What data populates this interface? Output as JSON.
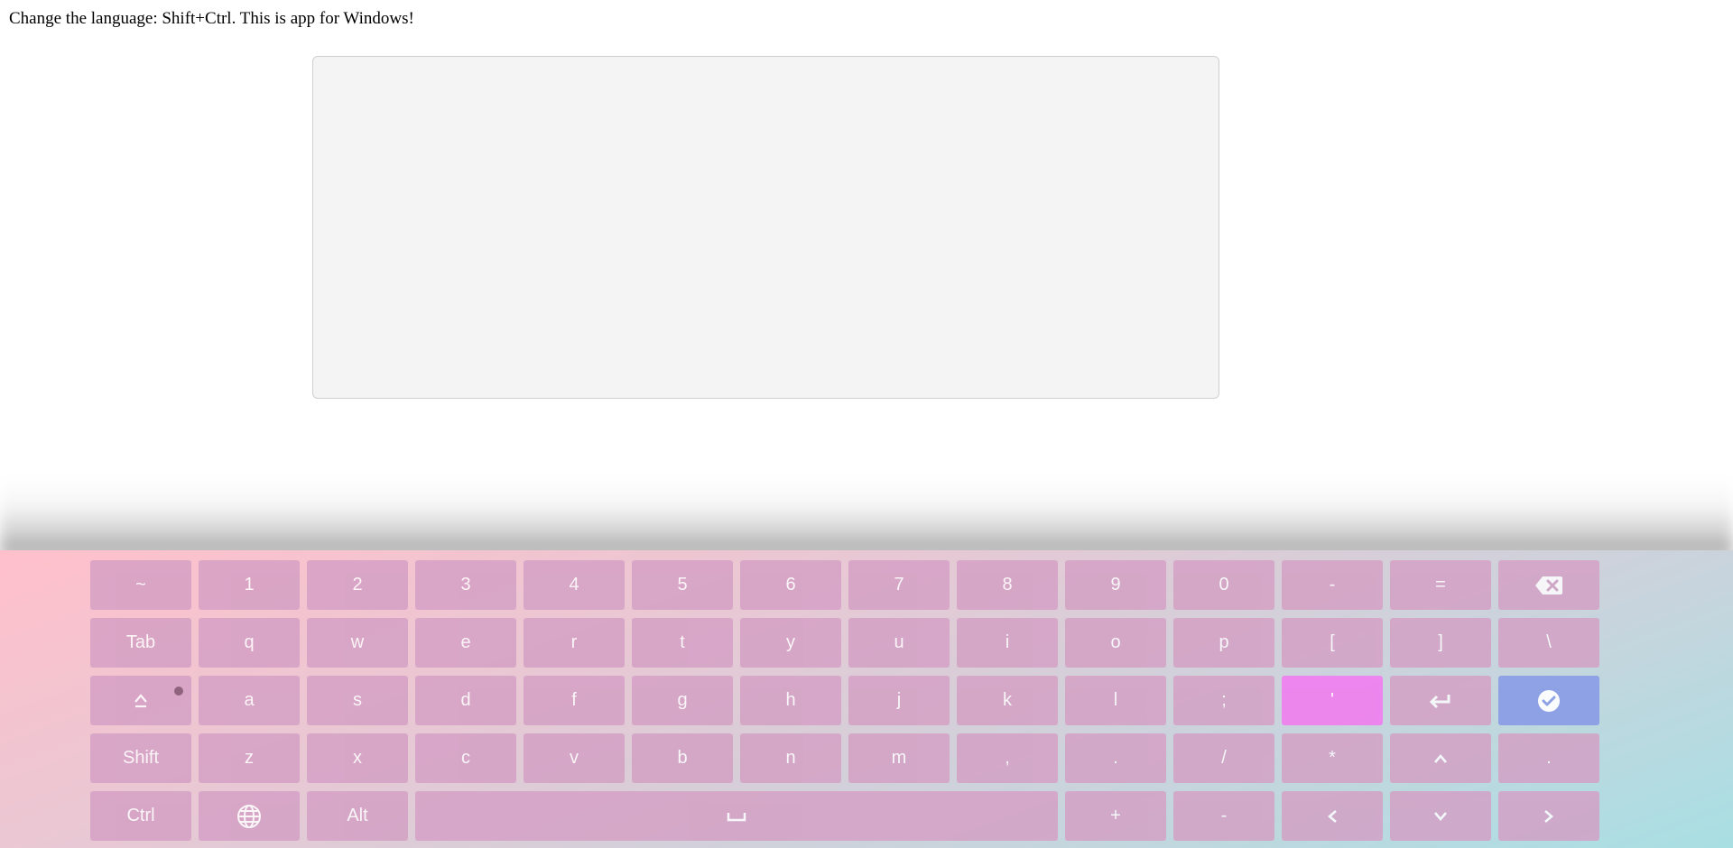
{
  "instruction": "Change the language: Shift+Ctrl. This is app for Windows!",
  "textarea": {
    "value": "",
    "placeholder": ""
  },
  "colors": {
    "key_default": "#d49fc4",
    "key_highlight": "#ee82ee",
    "key_done": "#8c9fe6",
    "gradient_start": "#ffc0cb",
    "gradient_end": "#a8dfe3"
  },
  "keyboard": {
    "rows": [
      [
        {
          "label": "~",
          "name": "key-tilde"
        },
        {
          "label": "1",
          "name": "key-1"
        },
        {
          "label": "2",
          "name": "key-2"
        },
        {
          "label": "3",
          "name": "key-3"
        },
        {
          "label": "4",
          "name": "key-4"
        },
        {
          "label": "5",
          "name": "key-5"
        },
        {
          "label": "6",
          "name": "key-6"
        },
        {
          "label": "7",
          "name": "key-7"
        },
        {
          "label": "8",
          "name": "key-8"
        },
        {
          "label": "9",
          "name": "key-9"
        },
        {
          "label": "0",
          "name": "key-0"
        },
        {
          "label": "-",
          "name": "key-minus"
        },
        {
          "label": "=",
          "name": "key-equals"
        },
        {
          "label": "",
          "name": "backspace-key",
          "icon": "backspace-icon"
        }
      ],
      [
        {
          "label": "Tab",
          "name": "key-tab"
        },
        {
          "label": "q",
          "name": "key-q"
        },
        {
          "label": "w",
          "name": "key-w"
        },
        {
          "label": "e",
          "name": "key-e"
        },
        {
          "label": "r",
          "name": "key-r"
        },
        {
          "label": "t",
          "name": "key-t"
        },
        {
          "label": "y",
          "name": "key-y"
        },
        {
          "label": "u",
          "name": "key-u"
        },
        {
          "label": "i",
          "name": "key-i"
        },
        {
          "label": "o",
          "name": "key-o"
        },
        {
          "label": "p",
          "name": "key-p"
        },
        {
          "label": "[",
          "name": "key-bracket-left"
        },
        {
          "label": "]",
          "name": "key-bracket-right"
        },
        {
          "label": "\\",
          "name": "key-backslash"
        }
      ],
      [
        {
          "label": "",
          "name": "caps-lock-key",
          "icon": "caps-lock-icon",
          "led": true
        },
        {
          "label": "a",
          "name": "key-a"
        },
        {
          "label": "s",
          "name": "key-s"
        },
        {
          "label": "d",
          "name": "key-d"
        },
        {
          "label": "f",
          "name": "key-f"
        },
        {
          "label": "g",
          "name": "key-g"
        },
        {
          "label": "h",
          "name": "key-h"
        },
        {
          "label": "j",
          "name": "key-j"
        },
        {
          "label": "k",
          "name": "key-k"
        },
        {
          "label": "l",
          "name": "key-l"
        },
        {
          "label": ";",
          "name": "key-semicolon"
        },
        {
          "label": "'",
          "name": "key-quote",
          "style": "highlight"
        },
        {
          "label": "",
          "name": "enter-key",
          "icon": "enter-icon"
        },
        {
          "label": "",
          "name": "done-key",
          "icon": "check-circle-icon",
          "style": "done"
        }
      ],
      [
        {
          "label": "Shift",
          "name": "key-shift"
        },
        {
          "label": "z",
          "name": "key-z"
        },
        {
          "label": "x",
          "name": "key-x"
        },
        {
          "label": "c",
          "name": "key-c"
        },
        {
          "label": "v",
          "name": "key-v"
        },
        {
          "label": "b",
          "name": "key-b"
        },
        {
          "label": "n",
          "name": "key-n"
        },
        {
          "label": "m",
          "name": "key-m"
        },
        {
          "label": ",",
          "name": "key-comma"
        },
        {
          "label": ".",
          "name": "key-period"
        },
        {
          "label": "/",
          "name": "key-slash"
        },
        {
          "label": "*",
          "name": "key-asterisk"
        },
        {
          "label": "",
          "name": "arrow-up-key",
          "icon": "chevron-up-icon"
        },
        {
          "label": ".",
          "name": "key-dot"
        }
      ],
      [
        {
          "label": "Ctrl",
          "name": "key-ctrl"
        },
        {
          "label": "",
          "name": "language-key",
          "icon": "globe-icon"
        },
        {
          "label": "Alt",
          "name": "key-alt"
        },
        {
          "label": "",
          "name": "space-key",
          "icon": "space-icon",
          "wide": true
        },
        {
          "label": "+",
          "name": "key-plus"
        },
        {
          "label": "-",
          "name": "key-numpad-minus"
        },
        {
          "label": "",
          "name": "arrow-left-key",
          "icon": "chevron-left-icon"
        },
        {
          "label": "",
          "name": "arrow-down-key",
          "icon": "chevron-down-icon"
        },
        {
          "label": "",
          "name": "arrow-right-key",
          "icon": "chevron-right-icon"
        }
      ]
    ]
  }
}
